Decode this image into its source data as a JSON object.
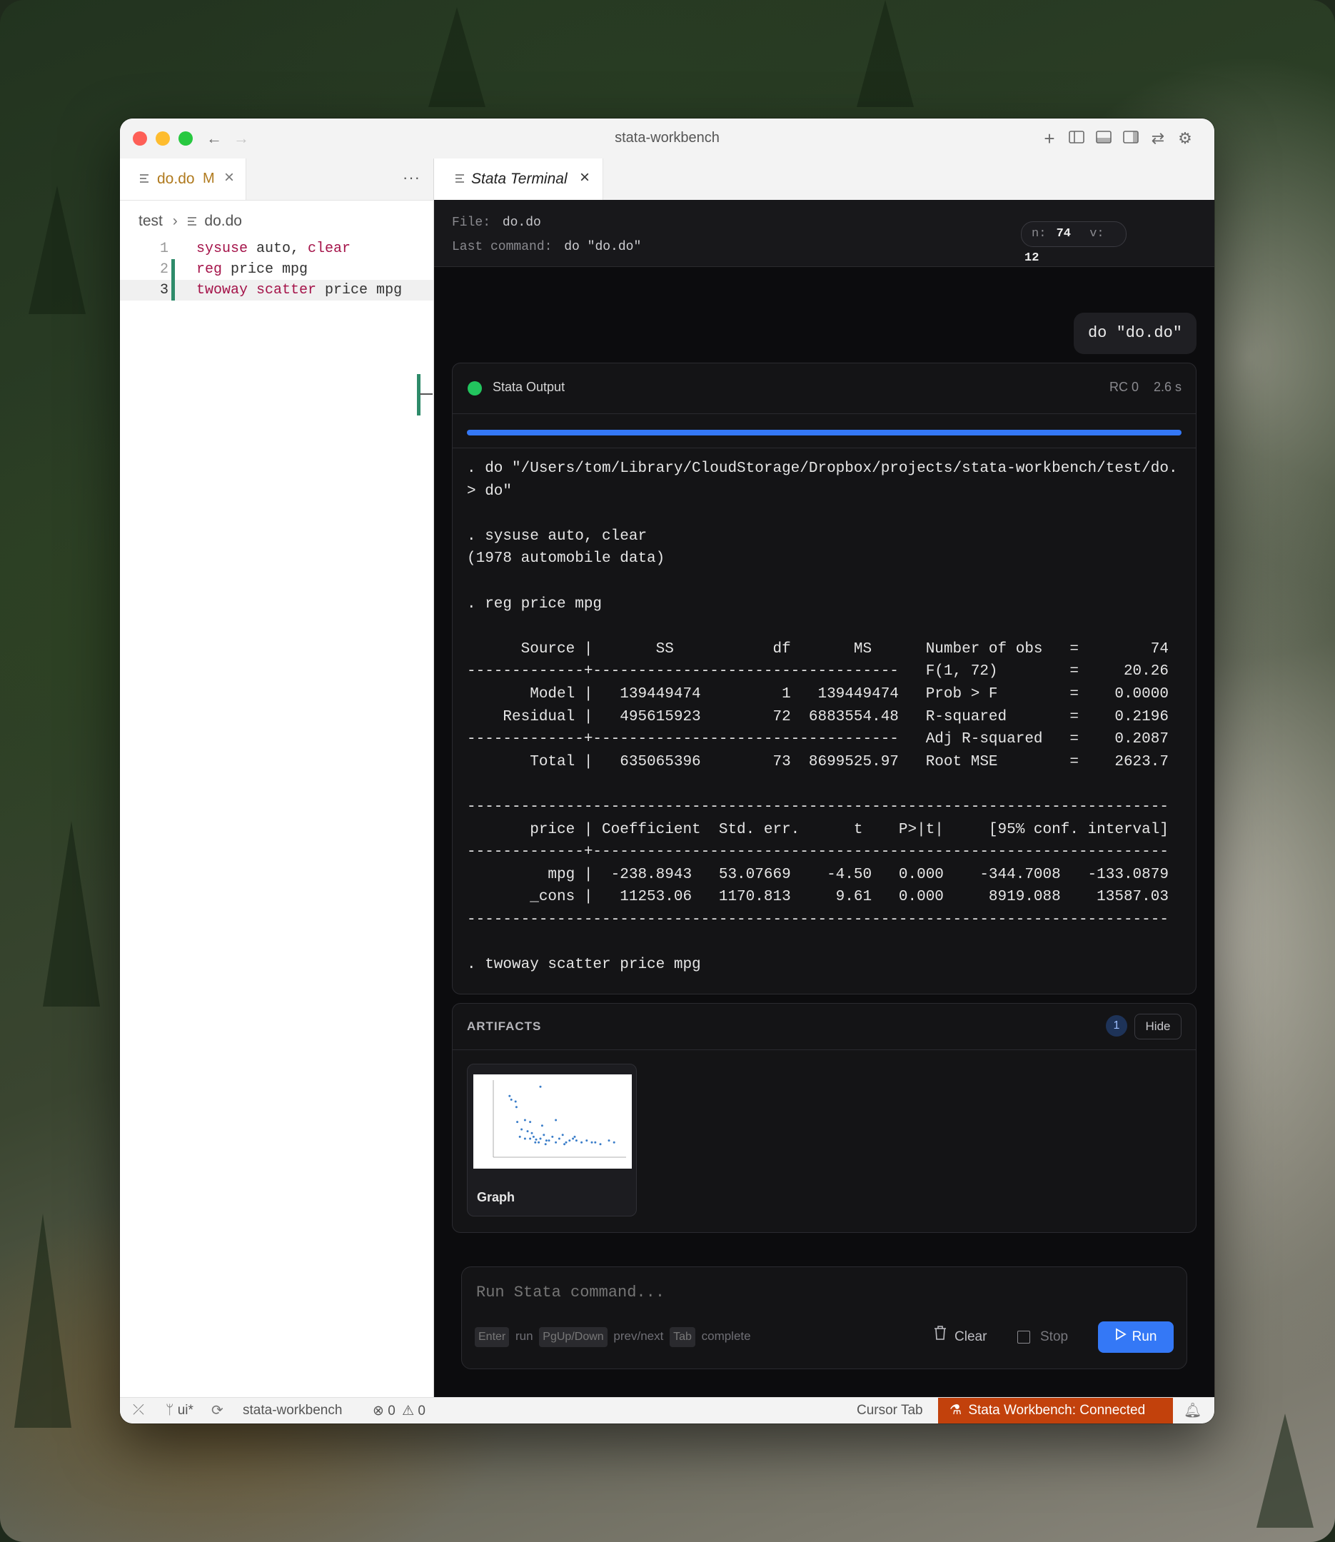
{
  "window": {
    "title": "stata-workbench"
  },
  "editor": {
    "tab": {
      "name": "do.do",
      "status": "M"
    },
    "breadcrumb": {
      "folder": "test",
      "file": "do.do"
    },
    "lines": [
      {
        "num": "1",
        "parts": [
          {
            "t": "sysuse",
            "k": true
          },
          {
            "t": " auto, "
          },
          {
            "t": "clear",
            "k": true
          }
        ]
      },
      {
        "num": "2",
        "parts": [
          {
            "t": "reg",
            "k": true
          },
          {
            "t": " price mpg"
          }
        ]
      },
      {
        "num": "3",
        "parts": [
          {
            "t": "twoway",
            "k": true
          },
          {
            "t": " "
          },
          {
            "t": "scatter",
            "k": true
          },
          {
            "t": " price mpg"
          }
        ]
      }
    ]
  },
  "terminal": {
    "tab": "Stata Terminal",
    "file_label": "File:",
    "file_value": "do.do",
    "lastcmd_label": "Last command:",
    "lastcmd_value": "do \"do.do\"",
    "n_label": "n:",
    "n_value": "74",
    "v_label": "v:",
    "v_value": "12",
    "user_command": "do \"do.do\"",
    "output": {
      "title": "Stata Output",
      "rc": "RC 0",
      "time": "2.6 s",
      "progress": 1.0,
      "text": ". do \"/Users/tom/Library/CloudStorage/Dropbox/projects/stata-workbench/test/do.\n> do\"\n\n. sysuse auto, clear\n(1978 automobile data)\n\n. reg price mpg\n\n      Source |       SS           df       MS      Number of obs   =        74\n-------------+----------------------------------   F(1, 72)        =     20.26\n       Model |   139449474         1   139449474   Prob > F        =    0.0000\n    Residual |   495615923        72  6883554.48   R-squared       =    0.2196\n-------------+----------------------------------   Adj R-squared   =    0.2087\n       Total |   635065396        73  8699525.97   Root MSE        =    2623.7\n\n------------------------------------------------------------------------------\n       price | Coefficient  Std. err.      t    P>|t|     [95% conf. interval]\n-------------+----------------------------------------------------------------\n         mpg |  -238.8943   53.07669    -4.50   0.000    -344.7008   -133.0879\n       _cons |   11253.06   1170.813     9.61   0.000     8919.088    13587.03\n------------------------------------------------------------------------------\n\n. twoway scatter price mpg"
    },
    "artifacts": {
      "title": "ARTIFACTS",
      "count": "1",
      "hide_label": "Hide",
      "items": [
        {
          "label": "Graph"
        }
      ]
    },
    "input": {
      "placeholder": "Run Stata command...",
      "hints": [
        {
          "key": "Enter",
          "desc": "run"
        },
        {
          "key": "PgUp/Down",
          "desc": "prev/next"
        },
        {
          "key": "Tab",
          "desc": "complete"
        }
      ],
      "clear_label": "Clear",
      "stop_label": "Stop",
      "run_label": "Run"
    }
  },
  "statusbar": {
    "branch": "ui*",
    "project": "stata-workbench",
    "errors": "0",
    "warnings": "0",
    "cursor_tab": "Cursor Tab",
    "connection": "Stata Workbench: Connected"
  },
  "colors": {
    "accent": "#3478f6",
    "status_ok": "#22c55e",
    "connected_bg": "#c2410c",
    "keyword": "#a5144a",
    "gutter_modified": "#2e8b6a"
  }
}
